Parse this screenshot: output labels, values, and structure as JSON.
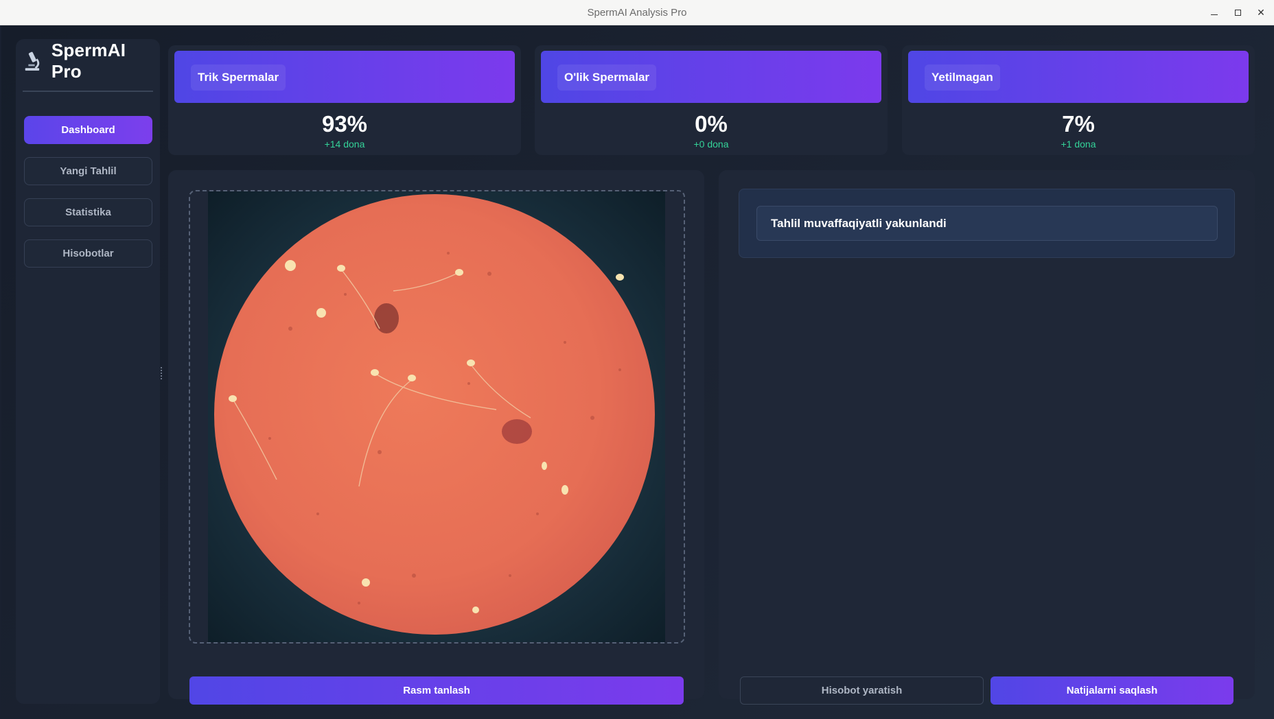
{
  "window": {
    "title": "SpermAI Analysis Pro"
  },
  "sidebar": {
    "brand": "SpermAI Pro",
    "items": [
      {
        "label": "Dashboard",
        "active": true
      },
      {
        "label": "Yangi Tahlil",
        "active": false
      },
      {
        "label": "Statistika",
        "active": false
      },
      {
        "label": "Hisobotlar",
        "active": false
      }
    ]
  },
  "stats": [
    {
      "label": "Trik Spermalar",
      "value": "93%",
      "delta": "+14 dona"
    },
    {
      "label": "O'lik Spermalar",
      "value": "0%",
      "delta": "+0 dona"
    },
    {
      "label": "Yetilmagan",
      "value": "7%",
      "delta": "+1 dona"
    }
  ],
  "image_panel": {
    "select_button": "Rasm tanlash"
  },
  "result_panel": {
    "message": "Tahlil muvaffaqiyatli yakunlandi",
    "report_button": "Hisobot yaratish",
    "save_button": "Natijalarni saqlash"
  },
  "colors": {
    "accent_start": "#4f46e5",
    "accent_end": "#7c3aed",
    "positive": "#34d399",
    "background": "#1a2130"
  },
  "icons": {
    "brand": "microscope-icon"
  }
}
